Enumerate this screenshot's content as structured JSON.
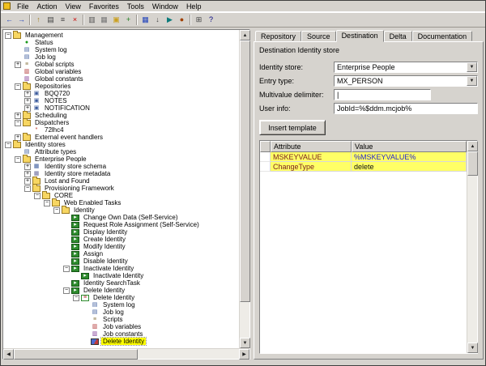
{
  "menu": {
    "items": [
      "File",
      "Action",
      "View",
      "Favorites",
      "Tools",
      "Window",
      "Help"
    ]
  },
  "toolbar": {
    "icons": [
      {
        "name": "back-icon",
        "glyph": "←",
        "color": "#2244bb"
      },
      {
        "name": "forward-icon",
        "glyph": "→",
        "color": "#2244bb"
      },
      {
        "name": "up-one-level-icon",
        "glyph": "↑",
        "color": "#a08020"
      },
      {
        "name": "show-tree-icon",
        "glyph": "▤",
        "color": "#444444"
      },
      {
        "name": "properties-icon",
        "glyph": "≡",
        "color": "#444444"
      },
      {
        "name": "delete-icon",
        "glyph": "×",
        "color": "#cc0000"
      },
      {
        "name": "copy-icon",
        "glyph": "▥",
        "color": "#555555"
      },
      {
        "name": "paste-icon",
        "glyph": "▦",
        "color": "#777777"
      },
      {
        "name": "new-entry-icon",
        "glyph": "▣",
        "color": "#caa020"
      },
      {
        "name": "insert-icon",
        "glyph": "+",
        "color": "#208020"
      },
      {
        "name": "save-icon",
        "glyph": "▦",
        "color": "#2244bb"
      },
      {
        "name": "export-icon",
        "glyph": "↓",
        "color": "#444444"
      },
      {
        "name": "run-job-icon",
        "glyph": "▶",
        "color": "#0a7a7a"
      },
      {
        "name": "test-run-icon",
        "glyph": "●",
        "color": "#a04000"
      },
      {
        "name": "new-window-icon",
        "glyph": "⊞",
        "color": "#444444"
      },
      {
        "name": "help-icon",
        "glyph": "?",
        "color": "#000080"
      }
    ]
  },
  "tree": {
    "items": [
      {
        "label": "Management",
        "level": 0,
        "exp": "-",
        "icon": "folder"
      },
      {
        "label": "Status",
        "level": 1,
        "icon": "status"
      },
      {
        "label": "System log",
        "level": 1,
        "icon": "log"
      },
      {
        "label": "Job log",
        "level": 1,
        "icon": "log"
      },
      {
        "label": "Global scripts",
        "level": 1,
        "exp": "+",
        "icon": "scripts"
      },
      {
        "label": "Global variables",
        "level": 1,
        "icon": "variables"
      },
      {
        "label": "Global constants",
        "level": 1,
        "icon": "constants"
      },
      {
        "label": "Repositories",
        "level": 1,
        "exp": "-",
        "icon": "folder"
      },
      {
        "label": "BQQ720",
        "level": 2,
        "exp": "+",
        "icon": "repository"
      },
      {
        "label": "NOTES",
        "level": 2,
        "exp": "+",
        "icon": "repository"
      },
      {
        "label": "NOTIFICATION",
        "level": 2,
        "exp": "+",
        "icon": "repository"
      },
      {
        "label": "Scheduling",
        "level": 1,
        "exp": "+",
        "icon": "folder"
      },
      {
        "label": "Dispatchers",
        "level": 1,
        "exp": "-",
        "icon": "folder"
      },
      {
        "label": "72lhc4",
        "level": 2,
        "icon": "dispatcher"
      },
      {
        "label": "External event handlers",
        "level": 1,
        "exp": "+",
        "icon": "folder"
      },
      {
        "label": "Identity stores",
        "level": 0,
        "exp": "-",
        "icon": "folder"
      },
      {
        "label": "Attribute types",
        "level": 1,
        "icon": "attribute"
      },
      {
        "label": "Enterprise People",
        "level": 1,
        "exp": "-",
        "icon": "folder"
      },
      {
        "label": "Identity store schema",
        "level": 2,
        "exp": "+",
        "icon": "schema"
      },
      {
        "label": "Identity store metadata",
        "level": 2,
        "exp": "+",
        "icon": "metadata"
      },
      {
        "label": "Lost and Found",
        "level": 2,
        "exp": "+",
        "icon": "folder"
      },
      {
        "label": "Provisioning Framework",
        "level": 2,
        "exp": "-",
        "icon": "folder"
      },
      {
        "label": "CORE",
        "level": 3,
        "exp": "-",
        "icon": "folder"
      },
      {
        "label": "Web Enabled Tasks",
        "level": 4,
        "exp": "-",
        "icon": "folder"
      },
      {
        "label": "Identity",
        "level": 5,
        "exp": "-",
        "icon": "folder"
      },
      {
        "label": "Change Own Data (Self-Service)",
        "level": 6,
        "icon": "task"
      },
      {
        "label": "Request Role Assignment (Self-Service)",
        "level": 6,
        "icon": "task"
      },
      {
        "label": "Display Identity",
        "level": 6,
        "icon": "task"
      },
      {
        "label": "Create Identity",
        "level": 6,
        "icon": "task"
      },
      {
        "label": "Modify Identity",
        "level": 6,
        "icon": "task"
      },
      {
        "label": "Assign",
        "level": 6,
        "icon": "task"
      },
      {
        "label": "Disable Identity",
        "level": 6,
        "icon": "task"
      },
      {
        "label": "Inactivate Identity",
        "level": 6,
        "exp": "-",
        "icon": "task"
      },
      {
        "label": "Inactivate Identity",
        "level": 7,
        "icon": "task"
      },
      {
        "label": "Identity SearchTask",
        "level": 6,
        "icon": "task"
      },
      {
        "label": "Delete Identity",
        "level": 6,
        "exp": "-",
        "icon": "task"
      },
      {
        "label": "Delete Identity",
        "level": 7,
        "exp": "-",
        "icon": "ordered"
      },
      {
        "label": "System log",
        "level": 8,
        "icon": "log"
      },
      {
        "label": "Job log",
        "level": 8,
        "icon": "log"
      },
      {
        "label": "Scripts",
        "level": 8,
        "icon": "scripts"
      },
      {
        "label": "Job variables",
        "level": 8,
        "icon": "variables"
      },
      {
        "label": "Job constants",
        "level": 8,
        "icon": "constants"
      },
      {
        "label": "Delete Identity",
        "level": 8,
        "icon": "job",
        "highlighted": true
      }
    ]
  },
  "tabs": {
    "items": [
      "Repository",
      "Source",
      "Destination",
      "Delta",
      "Documentation"
    ],
    "active": "Destination"
  },
  "form": {
    "group_title": "Destination Identity store",
    "fields": [
      {
        "name": "identity-store",
        "label": "Identity store:",
        "value": "Enterprise People",
        "control": "combo"
      },
      {
        "name": "entry-type",
        "label": "Entry type:",
        "value": "MX_PERSON",
        "control": "combo"
      },
      {
        "name": "multivalue-delimiter",
        "label": "Multivalue delimiter:",
        "value": "|",
        "control": "text",
        "short": true
      },
      {
        "name": "user-info",
        "label": "User info:",
        "value": "JobId=%$ddm.mcjob%",
        "control": "text"
      }
    ],
    "insert_template_label": "Insert template"
  },
  "grid": {
    "columns": [
      "Attribute",
      "Value"
    ],
    "rows": [
      {
        "attribute": "MSKEYVALUE",
        "value": "%MSKEYVALUE%",
        "attribute_color": "#7b2020",
        "value_color": "#2222cc",
        "highlighted": true
      },
      {
        "attribute": "ChangeType",
        "value": "delete",
        "attribute_color": "#7b2020",
        "value_color": "#111111",
        "highlighted": true
      }
    ]
  },
  "colors": {
    "tree_highlight": "#ffff00",
    "grid_row_highlight": "#ffff66"
  }
}
